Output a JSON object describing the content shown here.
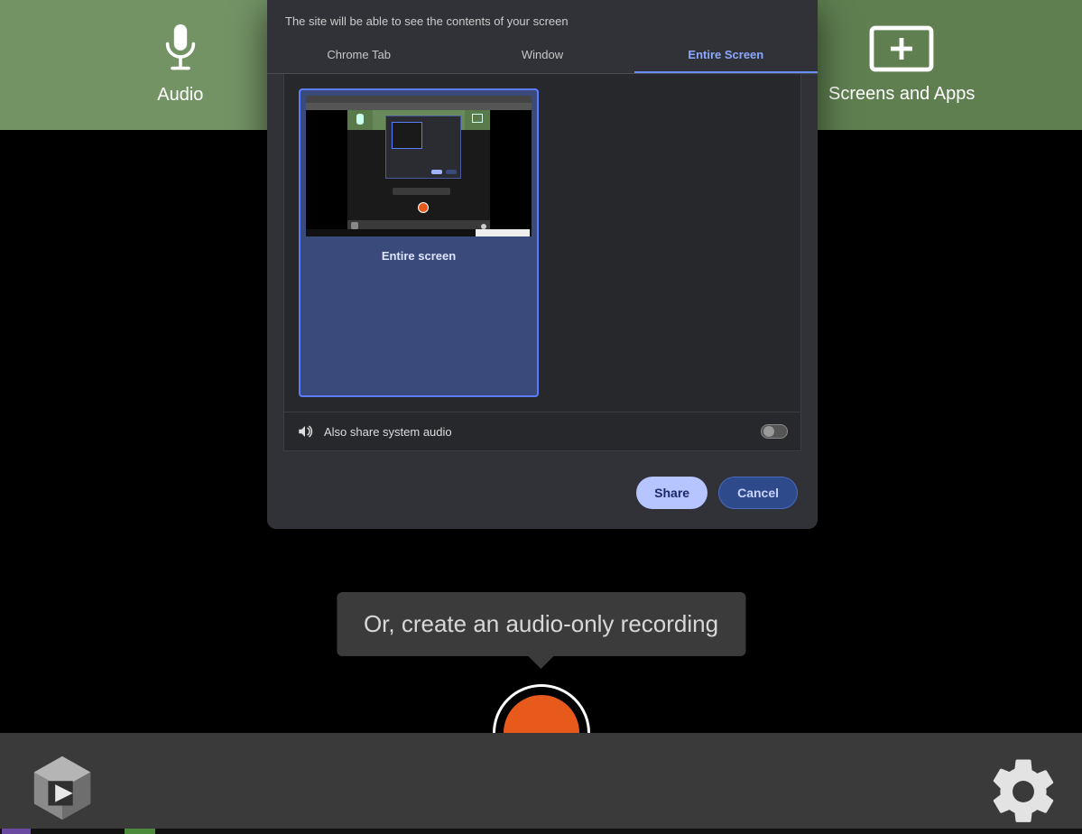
{
  "topbar": {
    "audio_label": "Audio",
    "screens_label": "Screens and Apps"
  },
  "dialog": {
    "subtitle": "The site will be able to see the contents of your screen",
    "tabs": {
      "chrome": "Chrome Tab",
      "window": "Window",
      "entire": "Entire Screen"
    },
    "thumbnail_caption": "Entire screen",
    "share_audio_label": "Also share system audio",
    "share_button": "Share",
    "cancel_button": "Cancel"
  },
  "tooltip": "Or, create an audio-only recording"
}
